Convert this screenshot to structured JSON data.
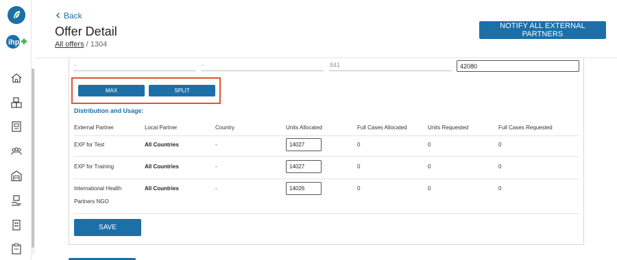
{
  "header": {
    "back_label": "Back",
    "title": "Offer Detail",
    "breadcrumb_link": "All offers",
    "breadcrumb_separator": "/",
    "breadcrumb_current": "1304",
    "notify_label": "NOTIFY ALL EXTERNAL PARTNERS"
  },
  "sidebar": {
    "items": [
      {
        "icon": "home-icon"
      },
      {
        "icon": "boxes-icon"
      },
      {
        "icon": "document-icon"
      },
      {
        "icon": "people-icon"
      },
      {
        "icon": "warehouse-icon"
      },
      {
        "icon": "hand-box-icon"
      },
      {
        "icon": "building-icon"
      },
      {
        "icon": "clipboard-icon"
      }
    ]
  },
  "prev_row": {
    "cells": [
      "-",
      "-",
      "841"
    ],
    "input_value": "42080"
  },
  "actions": {
    "max_label": "MAX",
    "split_label": "SPLIT"
  },
  "distribution": {
    "title": "Distribution and Usage:",
    "columns": [
      "External Partner",
      "Local Partner",
      "Country",
      "Units Allocated",
      "Full Cases Allocated",
      "Units Requested",
      "Full Cases Requested"
    ],
    "rows": [
      {
        "external_partner": "EXP for Test",
        "local_partner": "All Countries",
        "country": "-",
        "units_allocated": "14027",
        "full_cases_allocated": "0",
        "units_requested": "0",
        "full_cases_requested": "0"
      },
      {
        "external_partner": "EXP for Training",
        "local_partner": "All Countries",
        "country": "-",
        "units_allocated": "14027",
        "full_cases_allocated": "0",
        "units_requested": "0",
        "full_cases_requested": "0"
      },
      {
        "external_partner_line1": "International Health",
        "external_partner_line2": "Partners NGO",
        "local_partner": "All Countries",
        "country": "-",
        "units_allocated": "14026",
        "full_cases_allocated": "0",
        "units_requested": "0",
        "full_cases_requested": "0"
      }
    ],
    "save_label": "SAVE"
  },
  "colors": {
    "primary": "#1d6fa8",
    "highlight": "#e1522c",
    "logo_green": "#3fb24f"
  }
}
